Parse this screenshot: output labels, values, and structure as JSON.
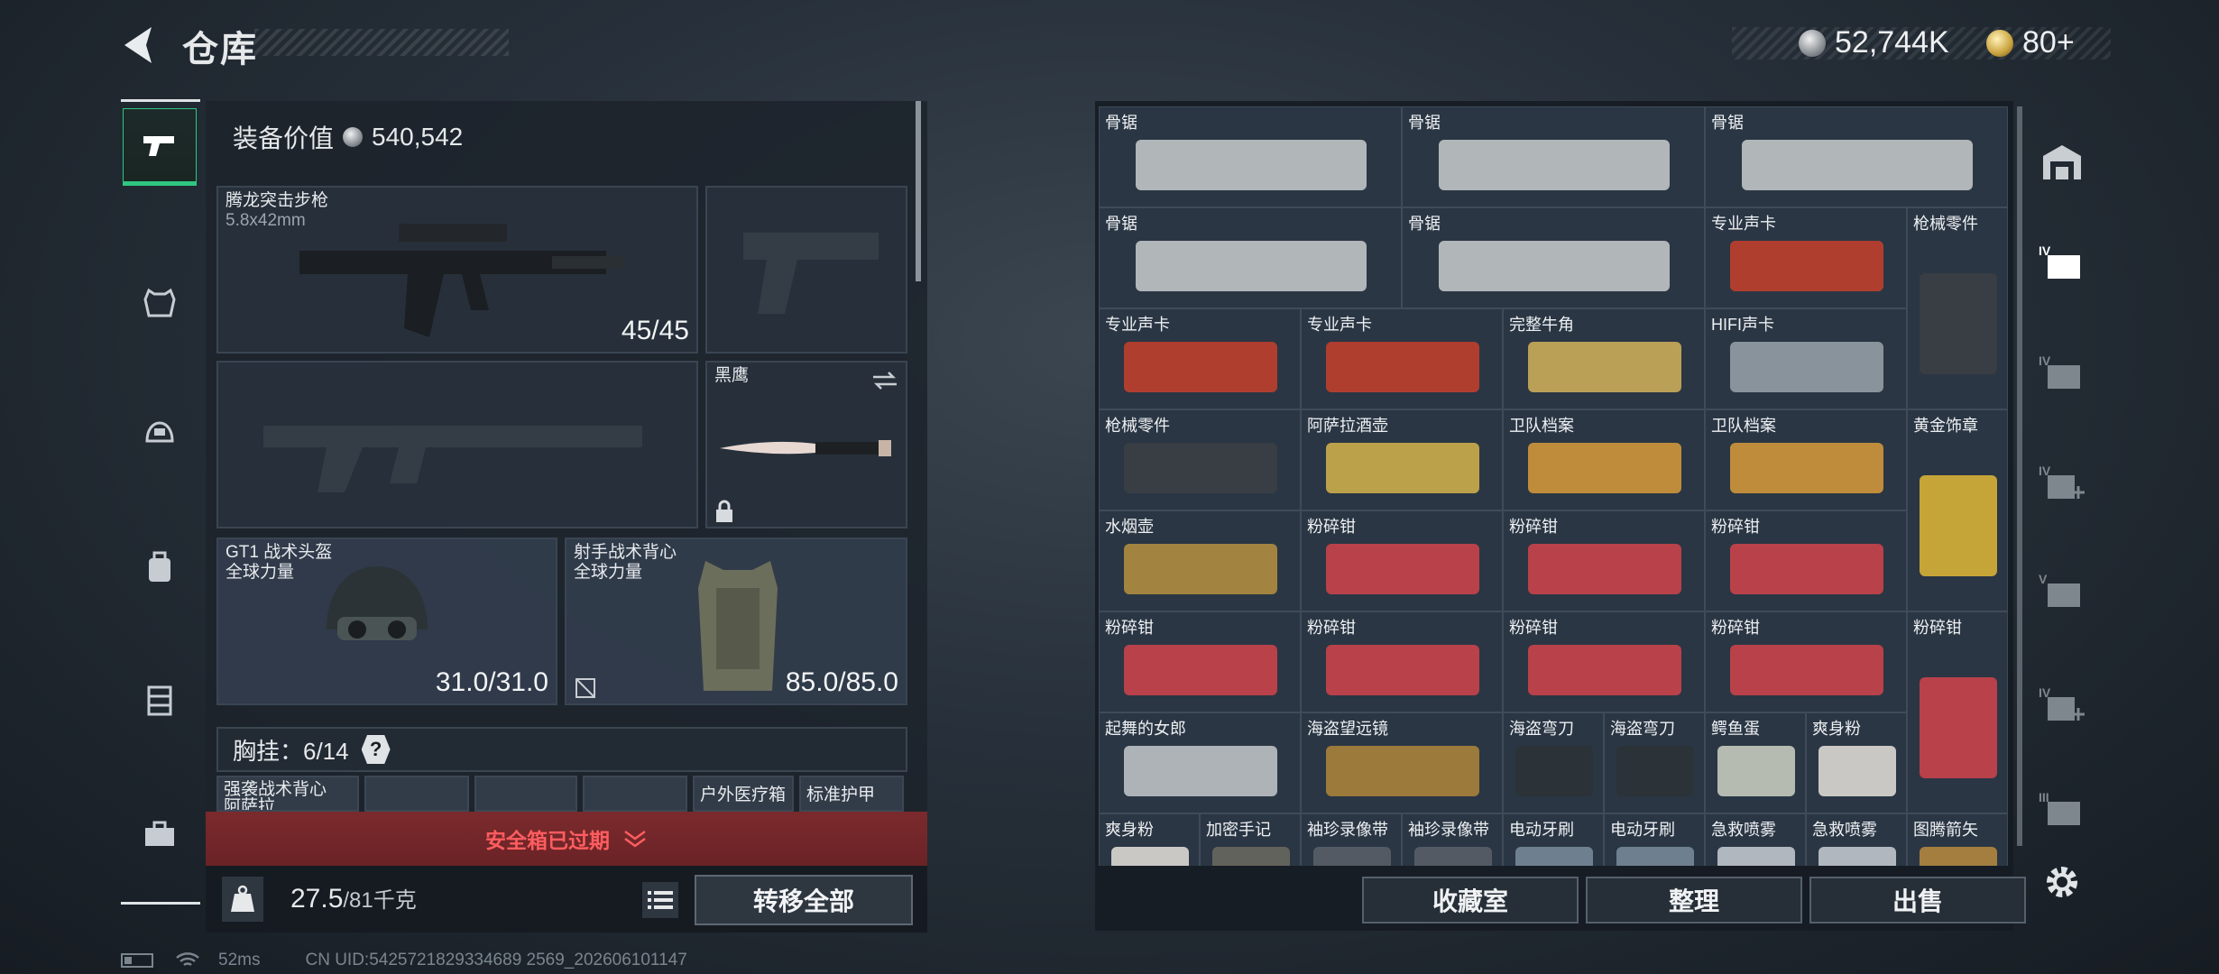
{
  "header": {
    "title": "仓库",
    "currency_silver": "52,744K",
    "currency_gold": "80+"
  },
  "loadout": {
    "value_label": "装备价值",
    "value": "540,542",
    "primary": {
      "name": "腾龙突击步枪",
      "caliber": "5.8x42mm",
      "ammo": "45/45"
    },
    "melee": {
      "name": "黑鹰"
    },
    "helmet": {
      "name": "GT1 战术头盔",
      "brand": "全球力量",
      "durability": "31.0/31.0"
    },
    "armor": {
      "name": "射手战术背心",
      "brand": "全球力量",
      "durability": "85.0/85.0"
    },
    "rig_label": "胸挂：6/14",
    "rig_help": "?",
    "rig_items": [
      "强袭战术背心\n阿萨拉",
      "",
      "",
      "",
      "户外医疗箱",
      "标准护甲"
    ],
    "secure_case_text": "安全箱已过期",
    "weight": "27.5",
    "weight_max": "/81千克",
    "transfer_all": "转移全部"
  },
  "storage": {
    "items": [
      {
        "label": "骨锯",
        "icon": "bone-saw"
      },
      {
        "label": "骨锯",
        "icon": "bone-saw"
      },
      {
        "label": "骨锯",
        "icon": "bone-saw"
      },
      {
        "label": "骨锯",
        "icon": "bone-saw"
      },
      {
        "label": "骨锯",
        "icon": "bone-saw"
      },
      {
        "label": "专业声卡",
        "icon": "sound-card"
      },
      {
        "label": "枪械零件",
        "icon": "gun-parts"
      },
      {
        "label": "专业声卡",
        "icon": "sound-card"
      },
      {
        "label": "专业声卡",
        "icon": "sound-card"
      },
      {
        "label": "完整牛角",
        "icon": "ox-horn"
      },
      {
        "label": "HIFI声卡",
        "icon": "hifi-card"
      },
      {
        "label": "枪械零件",
        "icon": "gun-parts"
      },
      {
        "label": "阿萨拉酒壶",
        "icon": "wine-pot"
      },
      {
        "label": "卫队档案",
        "icon": "archive"
      },
      {
        "label": "卫队档案",
        "icon": "archive"
      },
      {
        "label": "黄金饰章",
        "icon": "gold-badge"
      },
      {
        "label": "水烟壶",
        "icon": "hookah"
      },
      {
        "label": "粉碎钳",
        "icon": "crusher"
      },
      {
        "label": "粉碎钳",
        "icon": "crusher"
      },
      {
        "label": "粉碎钳",
        "icon": "crusher"
      },
      {
        "label": "粉碎钳",
        "icon": "crusher"
      },
      {
        "label": "粉碎钳",
        "icon": "crusher"
      },
      {
        "label": "粉碎钳",
        "icon": "crusher"
      },
      {
        "label": "粉碎钳",
        "icon": "crusher"
      },
      {
        "label": "粉碎钳",
        "icon": "crusher"
      },
      {
        "label": "起舞的女郎",
        "icon": "dancer"
      },
      {
        "label": "海盗望远镜",
        "icon": "telescope"
      },
      {
        "label": "海盗弯刀",
        "icon": "cutlass"
      },
      {
        "label": "海盗弯刀",
        "icon": "cutlass"
      },
      {
        "label": "鳄鱼蛋",
        "icon": "egg"
      },
      {
        "label": "爽身粉",
        "icon": "powder"
      },
      {
        "label": "爽身粉",
        "icon": "powder"
      },
      {
        "label": "加密手记",
        "icon": "notebook"
      },
      {
        "label": "袖珍录像带",
        "icon": "tape"
      },
      {
        "label": "袖珍录像带",
        "icon": "tape"
      },
      {
        "label": "电动牙刷",
        "icon": "toothbrush"
      },
      {
        "label": "电动牙刷",
        "icon": "toothbrush"
      },
      {
        "label": "急救喷雾",
        "icon": "spray"
      },
      {
        "label": "急救喷雾",
        "icon": "spray"
      },
      {
        "label": "图腾箭矢",
        "icon": "arrow"
      }
    ],
    "buttons": {
      "collection": "收藏室",
      "sort": "整理",
      "sell": "出售"
    }
  },
  "status": {
    "ping": "52ms",
    "uid": "CN UID:5425721829334689 2569_202606101147"
  },
  "colors": {
    "accent_green": "#2fc781",
    "warning_red": "#ff5d5f",
    "cell_bg": "#2a3644"
  }
}
